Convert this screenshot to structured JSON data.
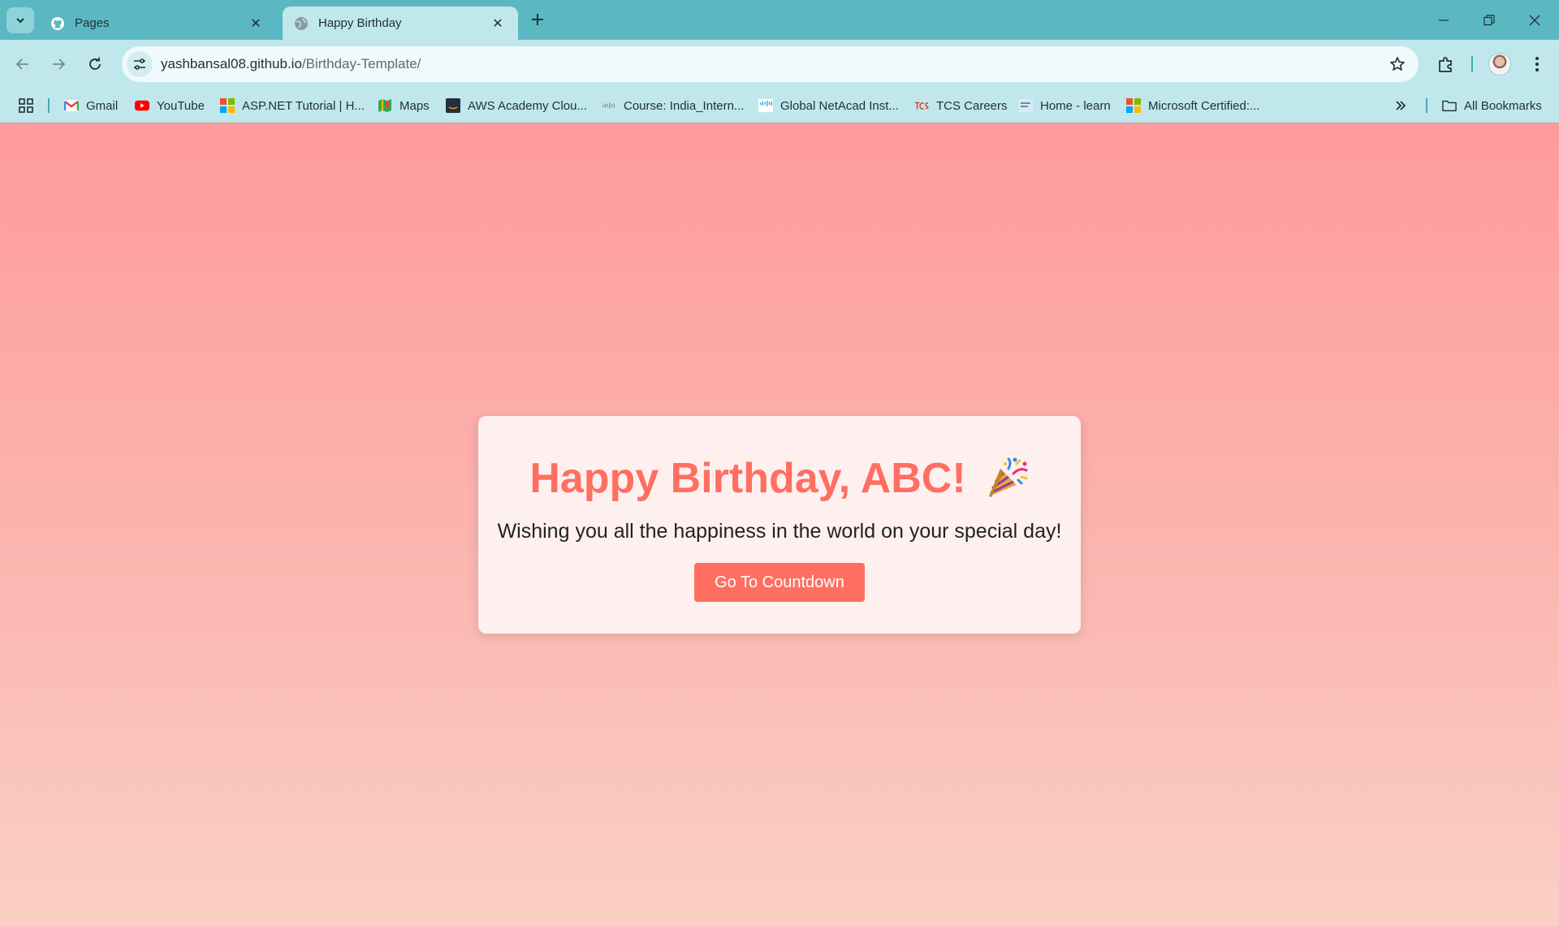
{
  "browser": {
    "tabs": [
      {
        "title": "Pages",
        "active": false,
        "favicon": "github-icon"
      },
      {
        "title": "Happy Birthday",
        "active": true,
        "favicon": "globe-icon"
      }
    ],
    "url_host": "yashbansal08.github.io",
    "url_path": "/Birthday-Template/",
    "bookmarks": [
      {
        "label": "Gmail",
        "icon": "gmail-icon"
      },
      {
        "label": "YouTube",
        "icon": "youtube-icon"
      },
      {
        "label": "ASP.NET Tutorial | H...",
        "icon": "microsoft-icon"
      },
      {
        "label": "Maps",
        "icon": "maps-icon"
      },
      {
        "label": "AWS Academy Clou...",
        "icon": "aws-icon"
      },
      {
        "label": "Course: India_Intern...",
        "icon": "cisco-icon"
      },
      {
        "label": "Global NetAcad Inst...",
        "icon": "cisco-icon"
      },
      {
        "label": "TCS Careers",
        "icon": "tcs-icon"
      },
      {
        "label": "Home - learn",
        "icon": "learn-icon"
      },
      {
        "label": "Microsoft Certified:...",
        "icon": "microsoft-icon"
      }
    ],
    "all_bookmarks_label": "All Bookmarks"
  },
  "page": {
    "heading": "Happy Birthday, ABC!",
    "heading_emoji": "party-popper-icon",
    "message": "Wishing you all the happiness in the world on your special day!",
    "button_label": "Go To Countdown"
  },
  "colors": {
    "tab_strip": "#5bb8c2",
    "toolbar": "#c0e7ec",
    "gradient_top": "#ff9a9e",
    "gradient_bottom": "#fad0c4",
    "card": "#fff0f0",
    "accent": "#ff6f61"
  }
}
